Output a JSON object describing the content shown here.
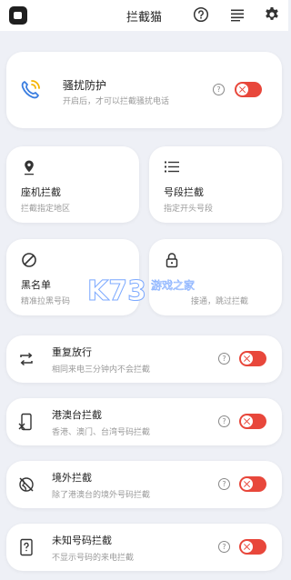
{
  "header": {
    "title": "拦截猫",
    "app_icon": "app-logo-icon",
    "icons": [
      "help-icon",
      "list-menu-icon",
      "gear-icon"
    ]
  },
  "main_card": {
    "title": "骚扰防护",
    "subtitle": "开启后，才可以拦截骚扰电话",
    "icon": "phone-signal-icon",
    "enabled": false
  },
  "grid": [
    {
      "title": "座机拦截",
      "subtitle": "拦截指定地区",
      "icon": "location-pin-icon"
    },
    {
      "title": "号段拦截",
      "subtitle": "指定开头号段",
      "icon": "list-icon"
    },
    {
      "title": "黑名单",
      "subtitle": "精准拉黑号码",
      "icon": "block-icon"
    },
    {
      "title": "",
      "subtitle": "接通，跳过拦截",
      "icon": "lock-icon"
    }
  ],
  "rows": [
    {
      "title": "重复放行",
      "subtitle": "相同来电三分钟内不会拦截",
      "icon": "repeat-icon",
      "enabled": false
    },
    {
      "title": "港澳台拦截",
      "subtitle": "香港、澳门、台湾号码拦截",
      "icon": "phone-cancel-icon",
      "enabled": false
    },
    {
      "title": "境外拦截",
      "subtitle": "除了港澳台的境外号码拦截",
      "icon": "globe-blocked-icon",
      "enabled": false
    },
    {
      "title": "未知号码拦截",
      "subtitle": "不显示号码的来电拦截",
      "icon": "unknown-phone-icon",
      "enabled": false
    }
  ],
  "watermark": {
    "text": "游戏之家"
  },
  "colors": {
    "accent": "#e8473b",
    "background": "#eef0f6",
    "card": "#ffffff",
    "phone_icon_blue": "#3a7de0",
    "phone_icon_yellow": "#f5b400"
  }
}
